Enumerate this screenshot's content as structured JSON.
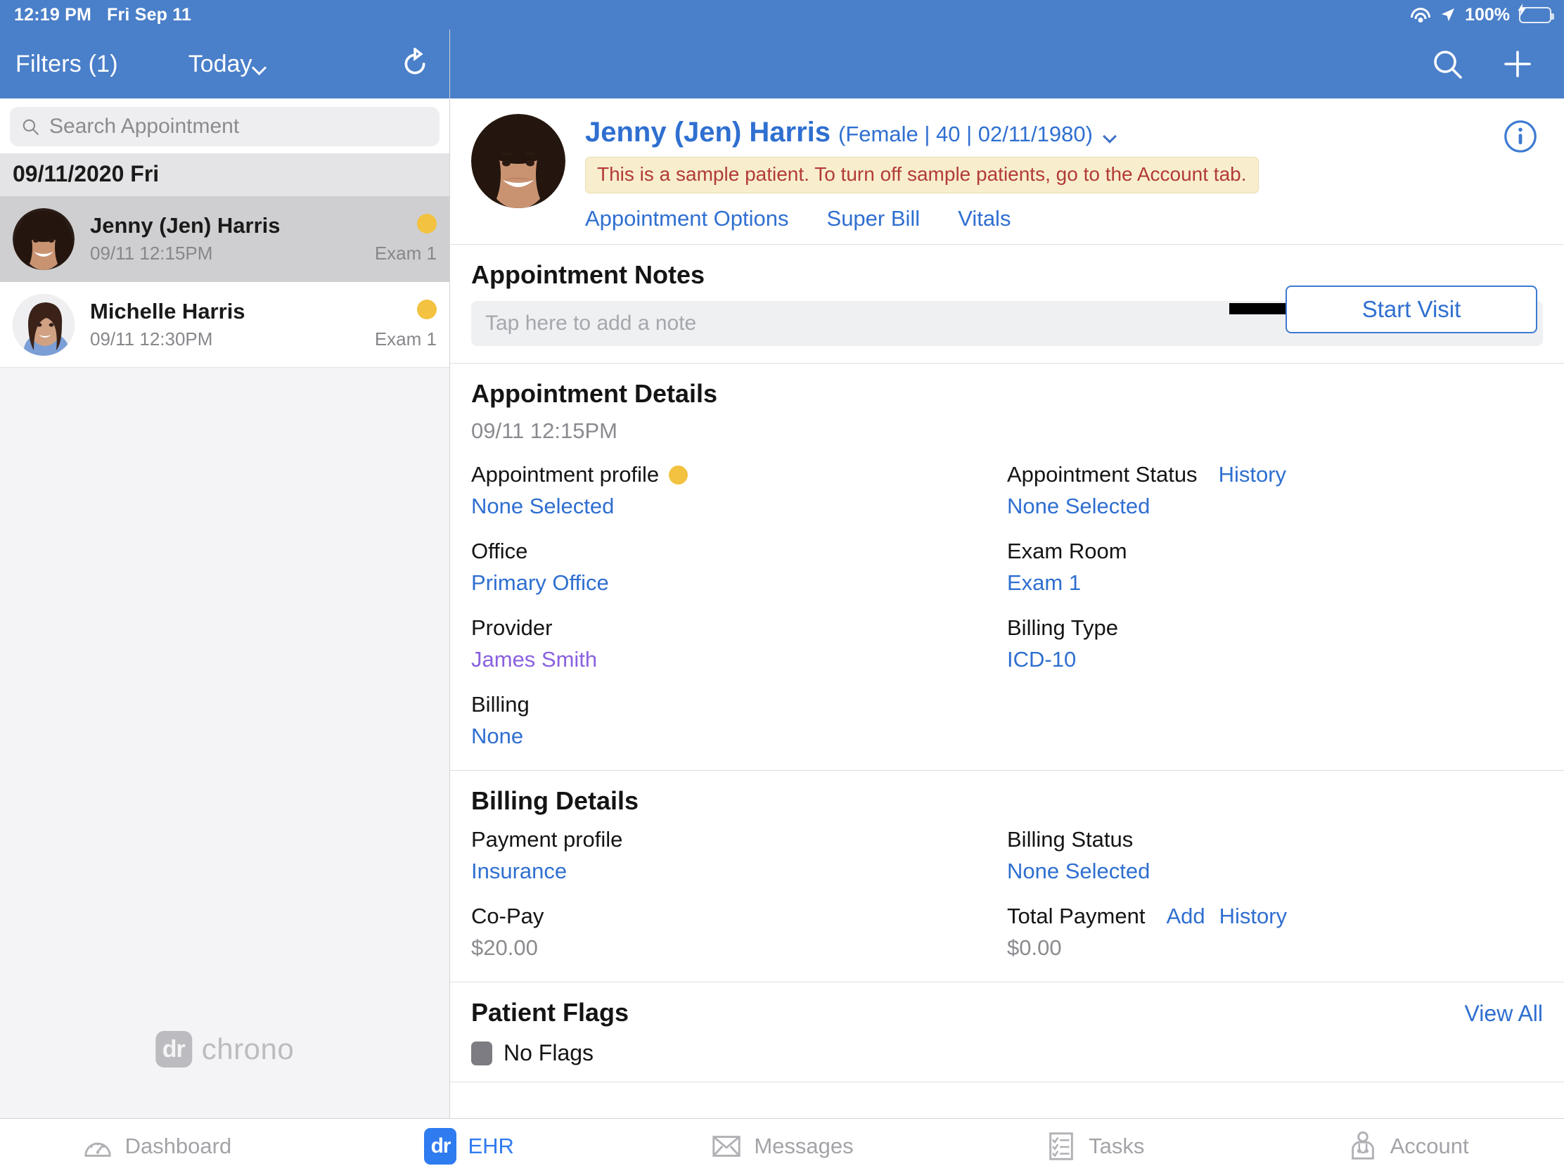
{
  "status_bar": {
    "time": "12:19 PM",
    "date": "Fri Sep 11",
    "battery": "100%"
  },
  "left_panel": {
    "filters_label": "Filters (1)",
    "today_label": "Today",
    "search_placeholder": "Search Appointment",
    "date_header": "09/11/2020 Fri",
    "appointments": [
      {
        "name": "Jenny (Jen) Harris",
        "time": "09/11 12:15PM",
        "room": "Exam 1",
        "selected": true
      },
      {
        "name": "Michelle Harris",
        "time": "09/11 12:30PM",
        "room": "Exam 1",
        "selected": false
      }
    ],
    "watermark_badge": "dr",
    "watermark_text": "chrono"
  },
  "patient": {
    "name": "Jenny (Jen) Harris",
    "demographics": "(Female | 40 | 02/11/1980)",
    "sample_banner": "This is a sample patient. To turn off sample patients, go to the Account tab.",
    "links": [
      "Appointment Options",
      "Super Bill",
      "Vitals"
    ],
    "start_visit_label": "Start Visit"
  },
  "appointment_notes": {
    "title": "Appointment Notes",
    "placeholder": "Tap here to add a note"
  },
  "appointment_details": {
    "title": "Appointment Details",
    "datetime": "09/11 12:15PM",
    "left_fields": [
      {
        "label": "Appointment profile",
        "value": "None Selected",
        "has_dot": true
      },
      {
        "label": "Office",
        "value": "Primary Office"
      },
      {
        "label": "Provider",
        "value": "James Smith",
        "value_color": "purple"
      },
      {
        "label": "Billing",
        "value": "None"
      }
    ],
    "right_fields": [
      {
        "label": "Appointment Status",
        "inline_link": "History",
        "value": "None Selected"
      },
      {
        "label": "Exam Room",
        "value": "Exam 1"
      },
      {
        "label": "Billing Type",
        "value": "ICD-10"
      }
    ]
  },
  "billing_details": {
    "title": "Billing Details",
    "left_fields": [
      {
        "label": "Payment profile",
        "value": "Insurance"
      },
      {
        "label": "Co-Pay",
        "value": "$20.00",
        "value_color": "gray"
      }
    ],
    "right_fields": [
      {
        "label": "Billing Status",
        "value": "None Selected"
      },
      {
        "label": "Total Payment",
        "inline_link": "Add",
        "inline_link2": "History",
        "value": "$0.00",
        "value_color": "gray"
      }
    ]
  },
  "patient_flags": {
    "title": "Patient Flags",
    "view_all": "View All",
    "flag_text": "No Flags"
  },
  "tabbar": [
    {
      "label": "Dashboard",
      "icon": "gauge-icon",
      "active": false
    },
    {
      "label": "EHR",
      "icon": "dr-logo-icon",
      "active": true
    },
    {
      "label": "Messages",
      "icon": "envelope-icon",
      "active": false
    },
    {
      "label": "Tasks",
      "icon": "checklist-icon",
      "active": false
    },
    {
      "label": "Account",
      "icon": "doctor-icon",
      "active": false
    }
  ],
  "colors": {
    "header_blue": "#4a7fc9",
    "link_blue": "#2f6fd0",
    "accent_yellow": "#f2c240",
    "banner_bg": "#f8eece",
    "banner_text": "#b23b36"
  }
}
